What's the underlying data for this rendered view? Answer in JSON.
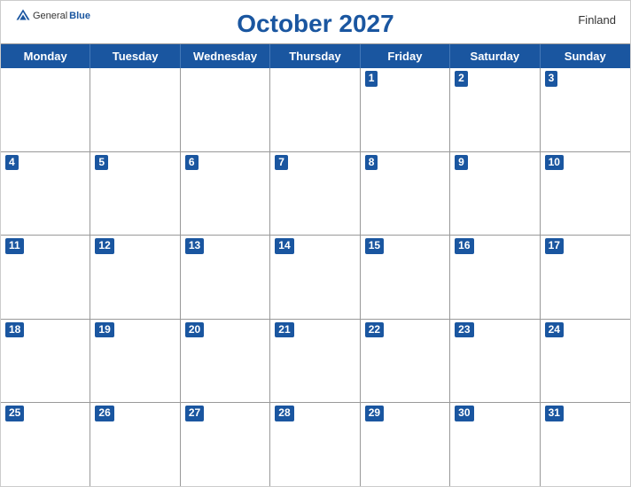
{
  "header": {
    "title": "October 2027",
    "country": "Finland",
    "logo_general": "General",
    "logo_blue": "Blue"
  },
  "days": {
    "headers": [
      "Monday",
      "Tuesday",
      "Wednesday",
      "Thursday",
      "Friday",
      "Saturday",
      "Sunday"
    ]
  },
  "weeks": [
    [
      {
        "date": "",
        "empty": true
      },
      {
        "date": "",
        "empty": true
      },
      {
        "date": "",
        "empty": true
      },
      {
        "date": "",
        "empty": true
      },
      {
        "date": "1"
      },
      {
        "date": "2"
      },
      {
        "date": "3"
      }
    ],
    [
      {
        "date": "4"
      },
      {
        "date": "5"
      },
      {
        "date": "6"
      },
      {
        "date": "7"
      },
      {
        "date": "8"
      },
      {
        "date": "9"
      },
      {
        "date": "10"
      }
    ],
    [
      {
        "date": "11"
      },
      {
        "date": "12"
      },
      {
        "date": "13"
      },
      {
        "date": "14"
      },
      {
        "date": "15"
      },
      {
        "date": "16"
      },
      {
        "date": "17"
      }
    ],
    [
      {
        "date": "18"
      },
      {
        "date": "19"
      },
      {
        "date": "20"
      },
      {
        "date": "21"
      },
      {
        "date": "22"
      },
      {
        "date": "23"
      },
      {
        "date": "24"
      }
    ],
    [
      {
        "date": "25"
      },
      {
        "date": "26"
      },
      {
        "date": "27"
      },
      {
        "date": "28"
      },
      {
        "date": "29"
      },
      {
        "date": "30"
      },
      {
        "date": "31"
      }
    ]
  ]
}
